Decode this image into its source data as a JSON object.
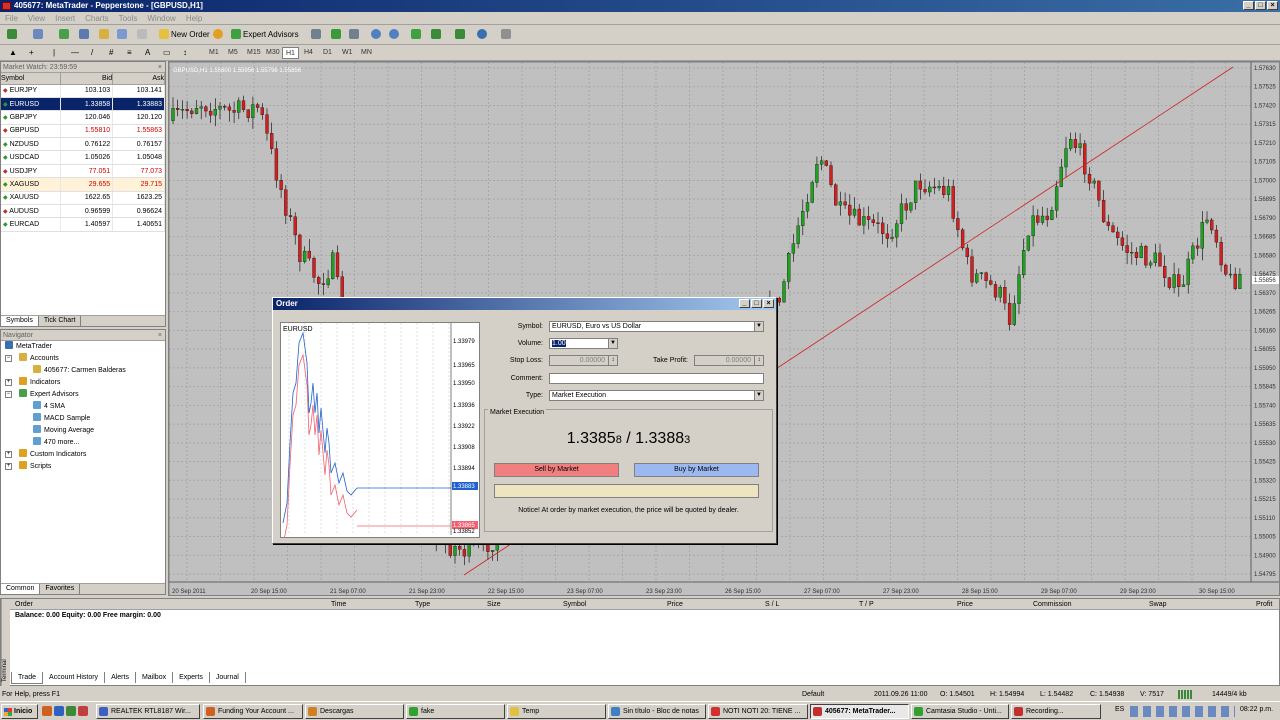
{
  "window": {
    "title": "405677: MetaTrader - Pepperstone - [GBPUSD,H1]",
    "controls": [
      "_",
      "□",
      "×"
    ]
  },
  "menu": [
    "File",
    "View",
    "Insert",
    "Charts",
    "Tools",
    "Window",
    "Help"
  ],
  "toolbar": {
    "new_order": "New Order",
    "expert_advisors": "Expert Advisors",
    "timeframes": [
      "M1",
      "M5",
      "M15",
      "M30",
      "H1",
      "H4",
      "D1",
      "W1",
      "MN"
    ],
    "active_timeframe": "H1",
    "letter_a": "A"
  },
  "market_watch": {
    "title": "Market Watch: 23:59:59",
    "columns": [
      "Symbol",
      "Bid",
      "Ask"
    ],
    "rows": [
      {
        "symbol": "EURJPY",
        "bid": "103.103",
        "ask": "103.141",
        "color": "#000000"
      },
      {
        "symbol": "EURUSD",
        "bid": "1.33858",
        "ask": "1.33883",
        "color": "#ffffff",
        "selected": true
      },
      {
        "symbol": "GBPJPY",
        "bid": "120.046",
        "ask": "120.120",
        "color": "#000000"
      },
      {
        "symbol": "GBPUSD",
        "bid": "1.55810",
        "ask": "1.55863",
        "color": "#cc0000"
      },
      {
        "symbol": "NZDUSD",
        "bid": "0.76122",
        "ask": "0.76157",
        "color": "#000000"
      },
      {
        "symbol": "USDCAD",
        "bid": "1.05026",
        "ask": "1.05048",
        "color": "#000000"
      },
      {
        "symbol": "USDJPY",
        "bid": "77.051",
        "ask": "77.073",
        "color": "#cc0000"
      },
      {
        "symbol": "XAGUSD",
        "bid": "29.655",
        "ask": "29.715",
        "color": "#cc0000"
      },
      {
        "symbol": "XAUUSD",
        "bid": "1622.65",
        "ask": "1623.25",
        "color": "#000000"
      },
      {
        "symbol": "AUDUSD",
        "bid": "0.96599",
        "ask": "0.96624",
        "color": "#000000"
      },
      {
        "symbol": "EURCAD",
        "bid": "1.40597",
        "ask": "1.40651",
        "color": "#000000"
      }
    ],
    "tabs": [
      "Symbols",
      "Tick Chart"
    ]
  },
  "navigator": {
    "title": "Navigator",
    "items": [
      {
        "label": "MetaTrader",
        "level": 0,
        "icon": "metatrader-icon"
      },
      {
        "label": "Accounts",
        "level": 1,
        "icon": "accounts-icon"
      },
      {
        "label": "405677: Carmen Balderas",
        "level": 2,
        "icon": "account-icon"
      },
      {
        "label": "Indicators",
        "level": 1,
        "icon": "indicators-icon"
      },
      {
        "label": "Expert Advisors",
        "level": 1,
        "icon": "experts-icon"
      },
      {
        "label": "4 SMA",
        "level": 2,
        "icon": "expert-icon"
      },
      {
        "label": "MACD Sample",
        "level": 2,
        "icon": "expert-icon"
      },
      {
        "label": "Moving Average",
        "level": 2,
        "icon": "expert-icon"
      },
      {
        "label": "470 more...",
        "level": 2,
        "icon": "more-icon"
      },
      {
        "label": "Custom Indicators",
        "level": 1,
        "icon": "custom-indicators-icon"
      },
      {
        "label": "Scripts",
        "level": 1,
        "icon": "scripts-icon"
      }
    ],
    "tabs": [
      "Common",
      "Favorites"
    ]
  },
  "chart": {
    "header": "GBPUSD,H1  1.55800 1.55956 1.55798 1.55856",
    "y_labels": [
      "1.57630",
      "1.57525",
      "1.57420",
      "1.57315",
      "1.57210",
      "1.57105",
      "1.57000",
      "1.56895",
      "1.56790",
      "1.56685",
      "1.56580",
      "1.56475",
      "1.56370",
      "1.56265",
      "1.56160",
      "1.56055",
      "1.55950",
      "1.55845",
      "1.55740",
      "1.55635",
      "1.55530",
      "1.55425",
      "1.55320",
      "1.55215",
      "1.55110",
      "1.55005",
      "1.54900",
      "1.54795"
    ],
    "current_price": "1.55856",
    "x_labels": [
      "20 Sep 2011",
      "20 Sep 15:00",
      "21 Sep 07:00",
      "21 Sep 23:00",
      "22 Sep 15:00",
      "23 Sep 07:00",
      "23 Sep 23:00",
      "26 Sep 15:00",
      "27 Sep 07:00",
      "27 Sep 23:00",
      "28 Sep 15:00",
      "29 Sep 07:00",
      "29 Sep 23:00",
      "30 Sep 15:00"
    ]
  },
  "order_dialog": {
    "title": "Order",
    "mini_chart_symbol": "EURUSD",
    "mini_y_labels": [
      "1.33979",
      "1.33965",
      "1.33950",
      "1.33936",
      "1.33922",
      "1.33908",
      "1.33894",
      "1.33883",
      "1.33865",
      "1.33852"
    ],
    "symbol_label": "Symbol:",
    "symbol_value": "EURUSD, Euro vs US Dollar",
    "volume_label": "Volume:",
    "volume_value": "1.00",
    "stop_loss_label": "Stop Loss:",
    "stop_loss_value": "0.00000",
    "take_profit_label": "Take Profit:",
    "take_profit_value": "0.00000",
    "comment_label": "Comment:",
    "comment_value": "",
    "type_label": "Type:",
    "type_value": "Market Execution",
    "section_label": "Market Execution",
    "bid_main": "1.3385",
    "bid_small": "8",
    "ask_main": "1.3388",
    "ask_small": "3",
    "separator": "/",
    "sell_button": "Sell by Market",
    "buy_button": "Buy by Market",
    "notice": "Notice! At order by market execution, the price will be quoted by dealer."
  },
  "terminal": {
    "columns": [
      "Order",
      "Time",
      "Type",
      "Size",
      "Symbol",
      "Price",
      "S / L",
      "T / P",
      "Price",
      "Commission",
      "Swap",
      "Profit"
    ],
    "balance_line": "Balance: 0.00  Equity: 0.00  Free margin: 0.00",
    "tabs": [
      "Trade",
      "Account History",
      "Alerts",
      "Mailbox",
      "Experts",
      "Journal"
    ],
    "side_label": "Terminal"
  },
  "status": {
    "help": "For Help, press F1",
    "profile": "Default",
    "datetime": "2011.09.26 11:00",
    "open": "O: 1.54501",
    "high": "H: 1.54994",
    "low": "L: 1.54482",
    "close": "C: 1.54938",
    "volume": "V: 7517",
    "traffic": "14449/4 kb"
  },
  "taskbar": {
    "start": "Inicio",
    "tasks": [
      "REALTEK RTL8187 Wir...",
      "Funding Your Account ...",
      "Descargas",
      "fake",
      "Temp",
      "Sin título - Bloc de notas",
      "NOTI NOTI 20: TIENE ...",
      "405677: MetaTrader...",
      "Camtasia Studio - Unti...",
      "Recording..."
    ],
    "lang": "ES",
    "clock": "08:22 p.m."
  }
}
